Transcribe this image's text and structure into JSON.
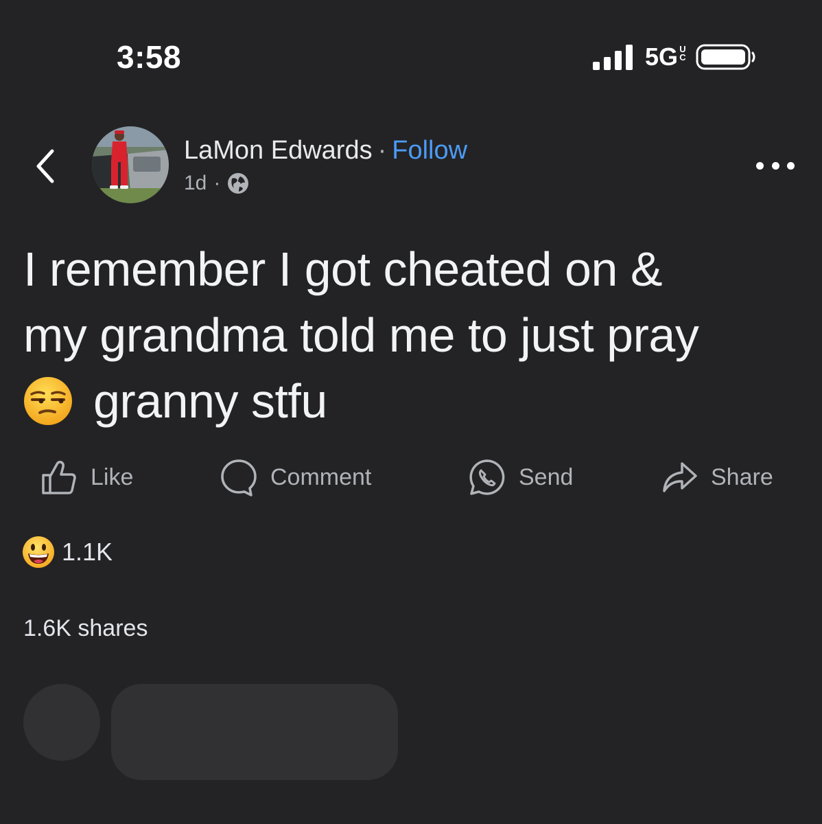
{
  "status_bar": {
    "time": "3:58",
    "network": "5G",
    "network_suffix": "UC"
  },
  "post": {
    "author": "LaMon Edwards",
    "separator": "·",
    "follow_label": "Follow",
    "age": "1d",
    "meta_separator": "·",
    "text_lines": [
      "I remember I got cheated on &",
      "my grandma told me to just pray",
      "granny stfu"
    ]
  },
  "actions": {
    "like": "Like",
    "comment": "Comment",
    "send": "Send",
    "share": "Share"
  },
  "engagement": {
    "reaction_count": "1.1K",
    "shares": "1.6K shares"
  },
  "icons": {
    "back": "chevron-left-icon",
    "globe": "globe-icon",
    "more": "more-horizontal-icon",
    "like": "thumbs-up-icon",
    "comment": "speech-bubble-icon",
    "send": "messenger-icon",
    "share": "share-arrow-icon",
    "reaction": "grinning-emoji",
    "post_emoji": "unamused-emoji"
  },
  "colors": {
    "background": "#232325",
    "link": "#4c9bf5",
    "secondary_text": "#b0b3b8",
    "primary_text": "#f2f3f5",
    "placeholder": "#313133"
  }
}
